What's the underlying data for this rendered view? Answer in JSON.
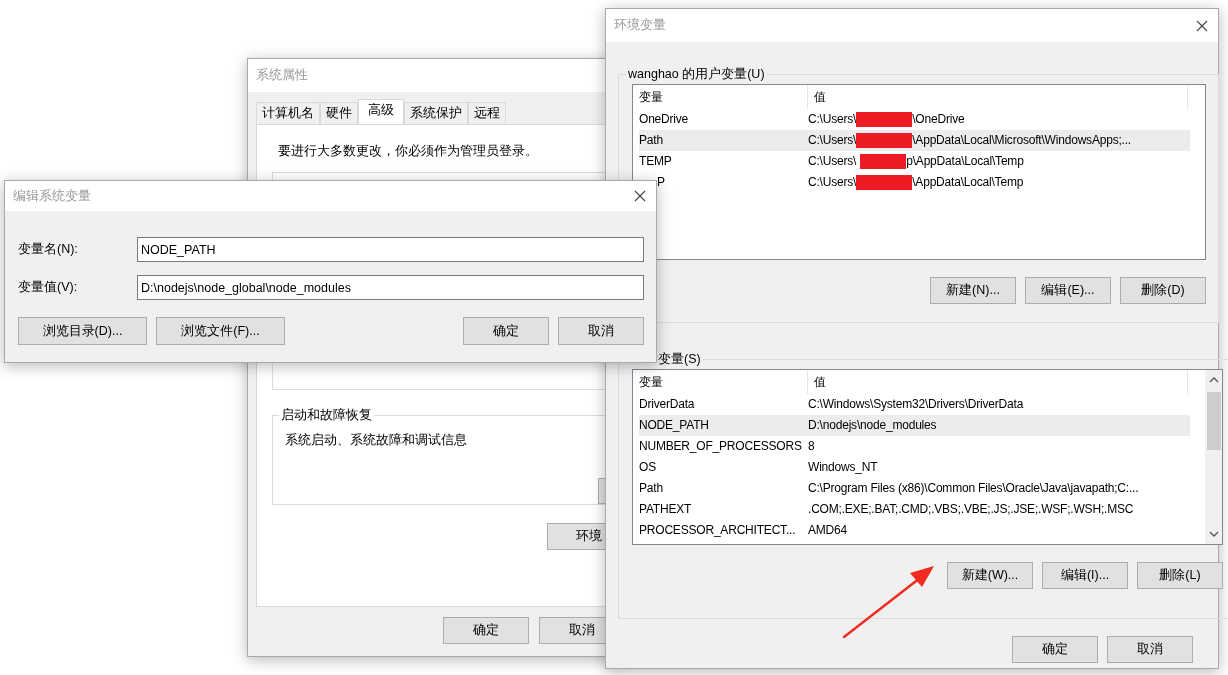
{
  "system_properties": {
    "title": "系统属性",
    "tabs": [
      {
        "label": "计算机名",
        "selected": false
      },
      {
        "label": "硬件",
        "selected": false
      },
      {
        "label": "高级",
        "selected": true
      },
      {
        "label": "系统保护",
        "selected": false
      },
      {
        "label": "远程",
        "selected": false
      }
    ],
    "notice": "要进行大多数更改，你必须作为管理员登录。",
    "startup_group": {
      "title": "启动和故障恢复",
      "text": "系统启动、系统故障和调试信息"
    },
    "environment_button": "环境",
    "buttons": [
      "确定",
      "取消"
    ]
  },
  "environment_variables": {
    "title": "环境变量",
    "user_variables": {
      "title": "wanghao 的用户变量(U)",
      "columns": [
        "变量",
        "值"
      ],
      "rows": [
        {
          "name": "OneDrive",
          "value_before": "C:\\Users\\",
          "value_after": "\\OneDrive",
          "redacted": true,
          "selected": false
        },
        {
          "name": "Path",
          "value_before": "C:\\Users\\",
          "value_after": "\\AppData\\Local\\Microsoft\\WindowsApps;...",
          "redacted": true,
          "selected": true
        },
        {
          "name": "TEMP",
          "value_before": "C:\\Users\\",
          "value_after": "p\\AppData\\Local\\Temp",
          "redacted": true,
          "selected": false
        },
        {
          "name": "P",
          "value_before": "C:\\Users\\",
          "value_after": "\\AppData\\Local\\Temp",
          "redacted": true,
          "selected": false
        }
      ],
      "buttons": [
        "新建(N)...",
        "编辑(E)...",
        "删除(D)"
      ]
    },
    "system_variables": {
      "title": "变量(S)",
      "columns": [
        "变量",
        "值"
      ],
      "rows": [
        {
          "name": "DriverData",
          "value_before": "C:\\Windows\\System32\\Drivers\\DriverData",
          "redacted": false,
          "selected": false
        },
        {
          "name": "NODE_PATH",
          "value_before": "D:\\nodejs\\node_modules",
          "redacted": false,
          "selected": true
        },
        {
          "name": "NUMBER_OF_PROCESSORS",
          "value_before": "8",
          "redacted": false,
          "selected": false
        },
        {
          "name": "OS",
          "value_before": "Windows_NT",
          "redacted": false,
          "selected": false
        },
        {
          "name": "Path",
          "value_before": "C:\\Program Files (x86)\\Common Files\\Oracle\\Java\\javapath;C:...",
          "redacted": false,
          "selected": false
        },
        {
          "name": "PATHEXT",
          "value_before": ".COM;.EXE;.BAT;.CMD;.VBS;.VBE;.JS;.JSE;.WSF;.WSH;.MSC",
          "redacted": false,
          "selected": false
        },
        {
          "name": "PROCESSOR_ARCHITECT...",
          "value_before": "AMD64",
          "redacted": false,
          "selected": false
        }
      ],
      "buttons": [
        "新建(W)...",
        "编辑(I)...",
        "删除(L)"
      ]
    },
    "buttons": [
      "确定",
      "取消"
    ]
  },
  "edit_dialog": {
    "title": "编辑系统变量",
    "fields": [
      {
        "label": "变量名(N):",
        "value": "NODE_PATH"
      },
      {
        "label": "变量值(V):",
        "value": "D:\\nodejs\\node_global\\node_modules"
      }
    ],
    "left_buttons": [
      "浏览目录(D)...",
      "浏览文件(F)..."
    ],
    "buttons": [
      "确定",
      "取消"
    ]
  }
}
